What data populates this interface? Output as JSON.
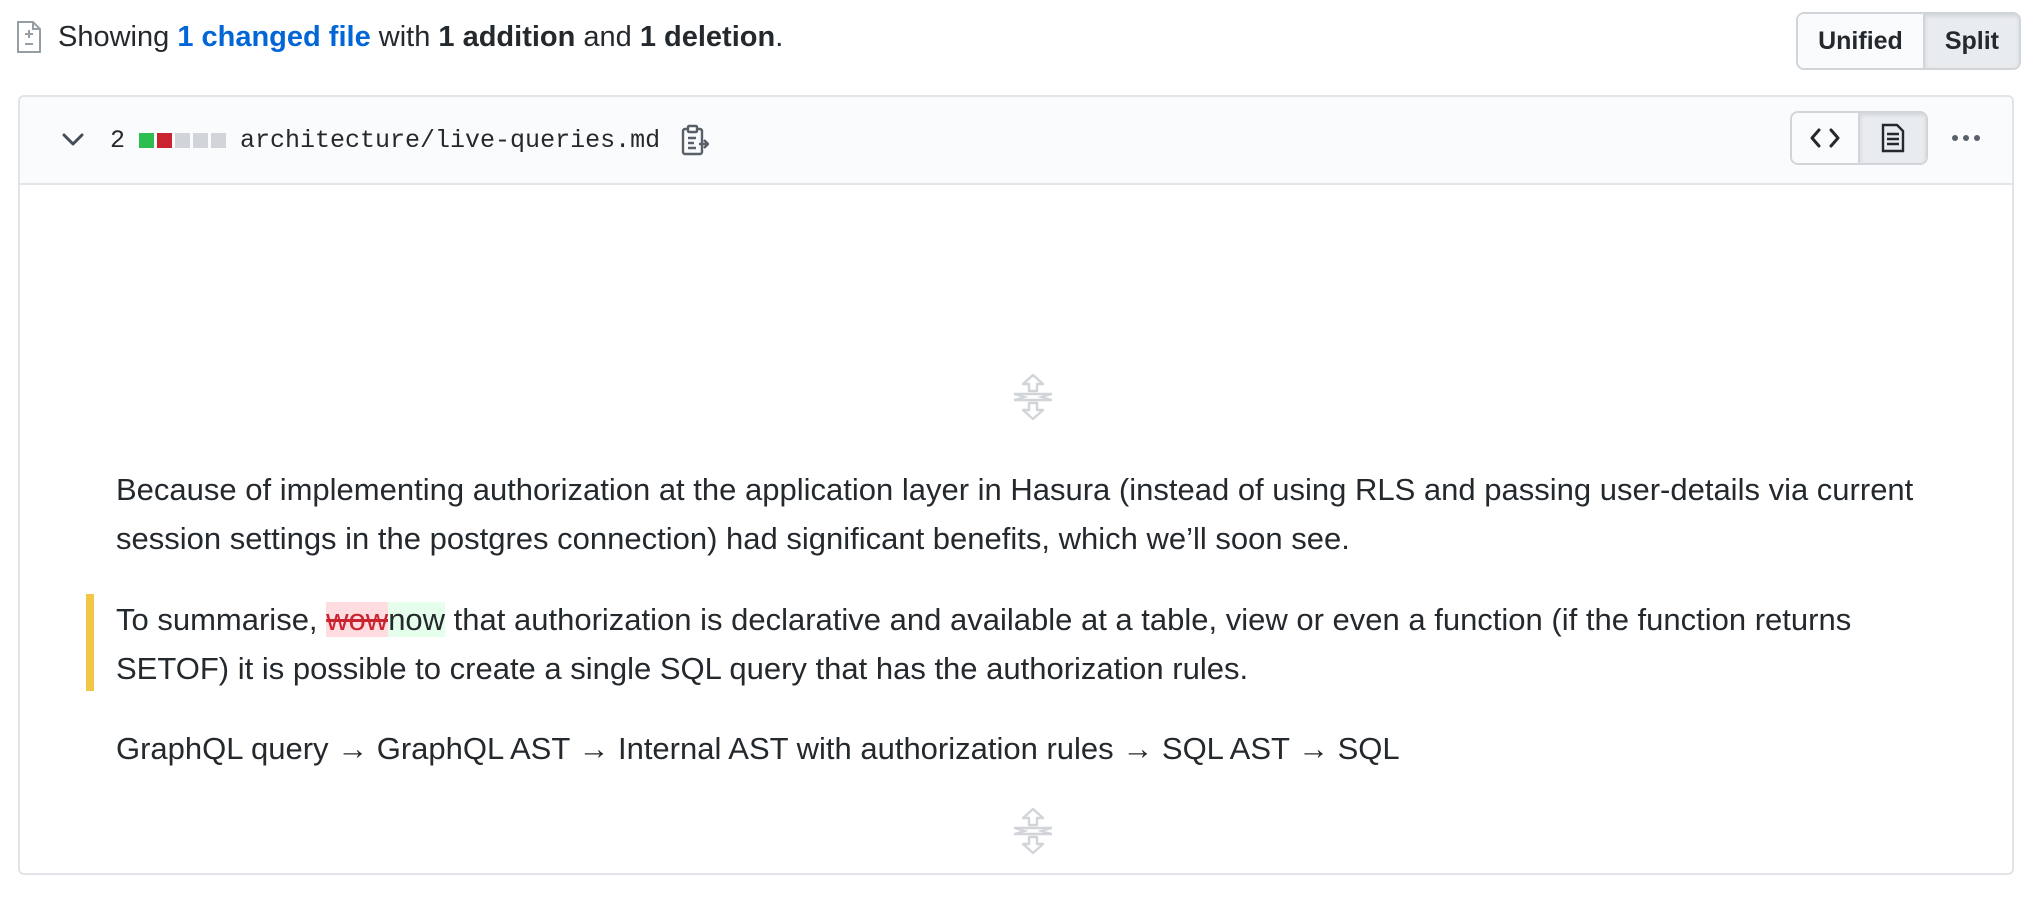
{
  "summary": {
    "prefix": "Showing ",
    "changed_link": "1 changed file",
    "with": " with ",
    "additions": "1 addition",
    "and": " and ",
    "deletions": "1 deletion",
    "suffix": "."
  },
  "view_toggle": {
    "unified_label": "Unified",
    "split_label": "Split",
    "selected": "Split"
  },
  "file": {
    "change_count": "2",
    "diffstat": [
      "added",
      "deleted",
      "neutral",
      "neutral",
      "neutral"
    ],
    "path": "architecture/live-queries.md",
    "view_mode_selected": "rich-diff"
  },
  "colors": {
    "added": "#2cbe4e",
    "deleted": "#cb2431",
    "neutral": "#d1d5da",
    "link": "#0366d6",
    "changed_marker": "#f1c745"
  },
  "prose": {
    "para1": "Because of implementing authorization at the application layer in Hasura (instead of using RLS and passing user-details via current session settings in the postgres connection) had significant benefits, which we’ll soon see.",
    "para2_before": "To summarise, ",
    "para2_deleted": "wow",
    "para2_added": "now",
    "para2_after": " that authorization is declarative and available at a table, view or even a function (if the function returns SETOF) it is possible to create a single SQL query that has the authorization rules.",
    "para3": "GraphQL query → GraphQL AST → Internal AST with authorization rules → SQL AST → SQL"
  }
}
